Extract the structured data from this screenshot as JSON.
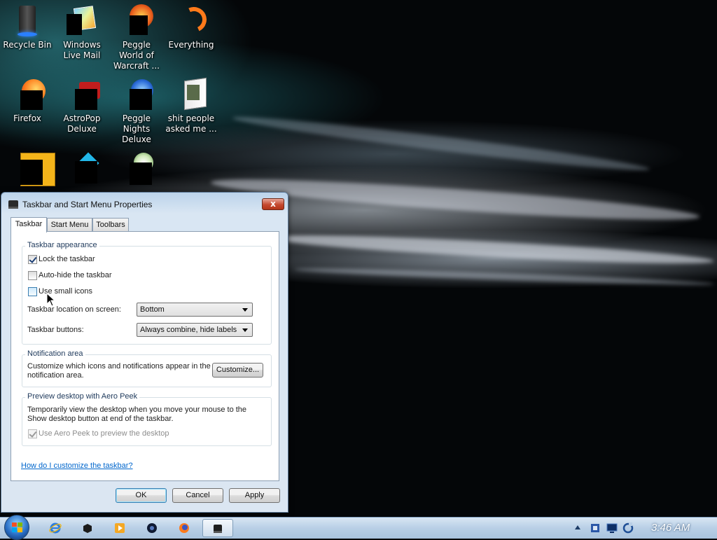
{
  "desktop": {
    "icons": [
      {
        "label": "Recycle Bin",
        "icon": "recycle-bin-icon"
      },
      {
        "label": "Windows Live Mail",
        "icon": "windows-live-mail-icon"
      },
      {
        "label": "Peggle World of Warcraft ...",
        "icon": "peggle-wow-icon"
      },
      {
        "label": "Everything",
        "icon": "everything-icon"
      },
      {
        "label": "Firefox",
        "icon": "firefox-icon"
      },
      {
        "label": "AstroPop Deluxe",
        "icon": "astropop-icon"
      },
      {
        "label": "Peggle Nights Deluxe",
        "icon": "peggle-nights-icon"
      },
      {
        "label": "shit people asked me ...",
        "icon": "folder-icon"
      },
      {
        "label": "",
        "icon": "bejeweled-icon"
      },
      {
        "label": "",
        "icon": "crystal-icon"
      },
      {
        "label": "",
        "icon": "flower-icon"
      }
    ]
  },
  "dialog": {
    "title": "Taskbar and Start Menu Properties",
    "close_label": "x",
    "tabs": [
      "Taskbar",
      "Start Menu",
      "Toolbars"
    ],
    "appearance": {
      "group_label": "Taskbar appearance",
      "lock_label": "Lock the taskbar",
      "lock_checked": true,
      "autohide_label": "Auto-hide the taskbar",
      "autohide_checked": false,
      "small_icons_label": "Use small icons",
      "small_icons_checked": false,
      "location_label": "Taskbar location on screen:",
      "location_value": "Bottom",
      "buttons_label": "Taskbar buttons:",
      "buttons_value": "Always combine, hide labels"
    },
    "notification": {
      "group_label": "Notification area",
      "description": "Customize which icons and notifications appear in the notification area.",
      "customize_button": "Customize..."
    },
    "aero_peek": {
      "group_label": "Preview desktop with Aero Peek",
      "description": "Temporarily view the desktop when you move your mouse to the Show desktop button at end of the taskbar.",
      "checkbox_label": "Use Aero Peek to preview the desktop",
      "checked": true,
      "enabled": false
    },
    "help_link": "How do I customize the taskbar?",
    "buttons": {
      "ok": "OK",
      "cancel": "Cancel",
      "apply": "Apply"
    }
  },
  "taskbar": {
    "pinned": [
      "internet-explorer-icon",
      "app-icon",
      "media-player-icon",
      "app-icon",
      "firefox-icon",
      "taskbar-properties-icon"
    ],
    "tray_icons": [
      "show-hidden-icons-arrow",
      "network-icon",
      "display-icon",
      "sync-icon"
    ],
    "clock": "3:46 AM"
  }
}
